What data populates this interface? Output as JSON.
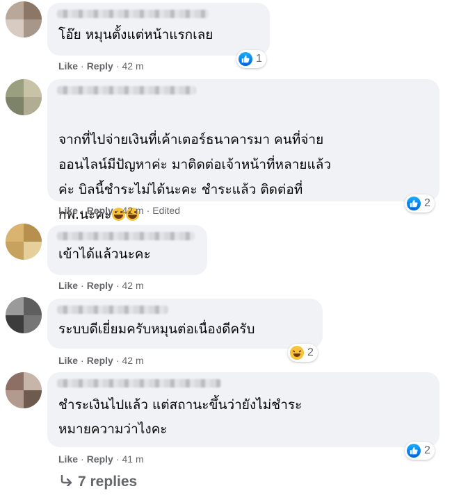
{
  "comments": [
    {
      "text": "โอ๊ย หมุนตั้งแต่หน้าแรกเลย",
      "like": "Like",
      "reply": "Reply",
      "time": "42 m",
      "edited": "",
      "reaction": {
        "type": "like",
        "count": "1"
      }
    },
    {
      "text": "จากที่ไปจ่ายเงินที่เค้าเตอร์ธนาคารมา คนที่จ่าย\nออนไลน์มีปัญหาค่ะ มาติดต่อเจ้าหน้าที่หลายแล้ว\nค่ะ บิลนี้ชำระไม่ได้นะคะ ชำระแล้ว ติดต่อที่\nกพ.นะคะ",
      "like": "Like",
      "reply": "Reply",
      "time": "42 m",
      "edited": "Edited",
      "reaction": {
        "type": "like",
        "count": "2"
      }
    },
    {
      "text": "เข้าได้แล้วนะคะ",
      "like": "Like",
      "reply": "Reply",
      "time": "42 m",
      "edited": "",
      "reaction": null
    },
    {
      "text": "ระบบดีเยี่ยมครับหมุนต่อเนื่องดีครับ",
      "like": "Like",
      "reply": "Reply",
      "time": "42 m",
      "edited": "",
      "reaction": {
        "type": "haha",
        "count": "2"
      }
    },
    {
      "text": "ชำระเงินไปแล้ว แต่สถานะขึ้นว่ายังไม่ชำระ\nหมายความว่าไงคะ",
      "like": "Like",
      "reply": "Reply",
      "time": "41 m",
      "edited": "",
      "reaction": {
        "type": "like",
        "count": "2"
      }
    }
  ],
  "replies_label": "7 replies",
  "colors": {
    "bubble": "#f0f2f5",
    "meta": "#65676b",
    "like_blue": "#0866ff",
    "haha_yellow": "#f7c33b"
  }
}
